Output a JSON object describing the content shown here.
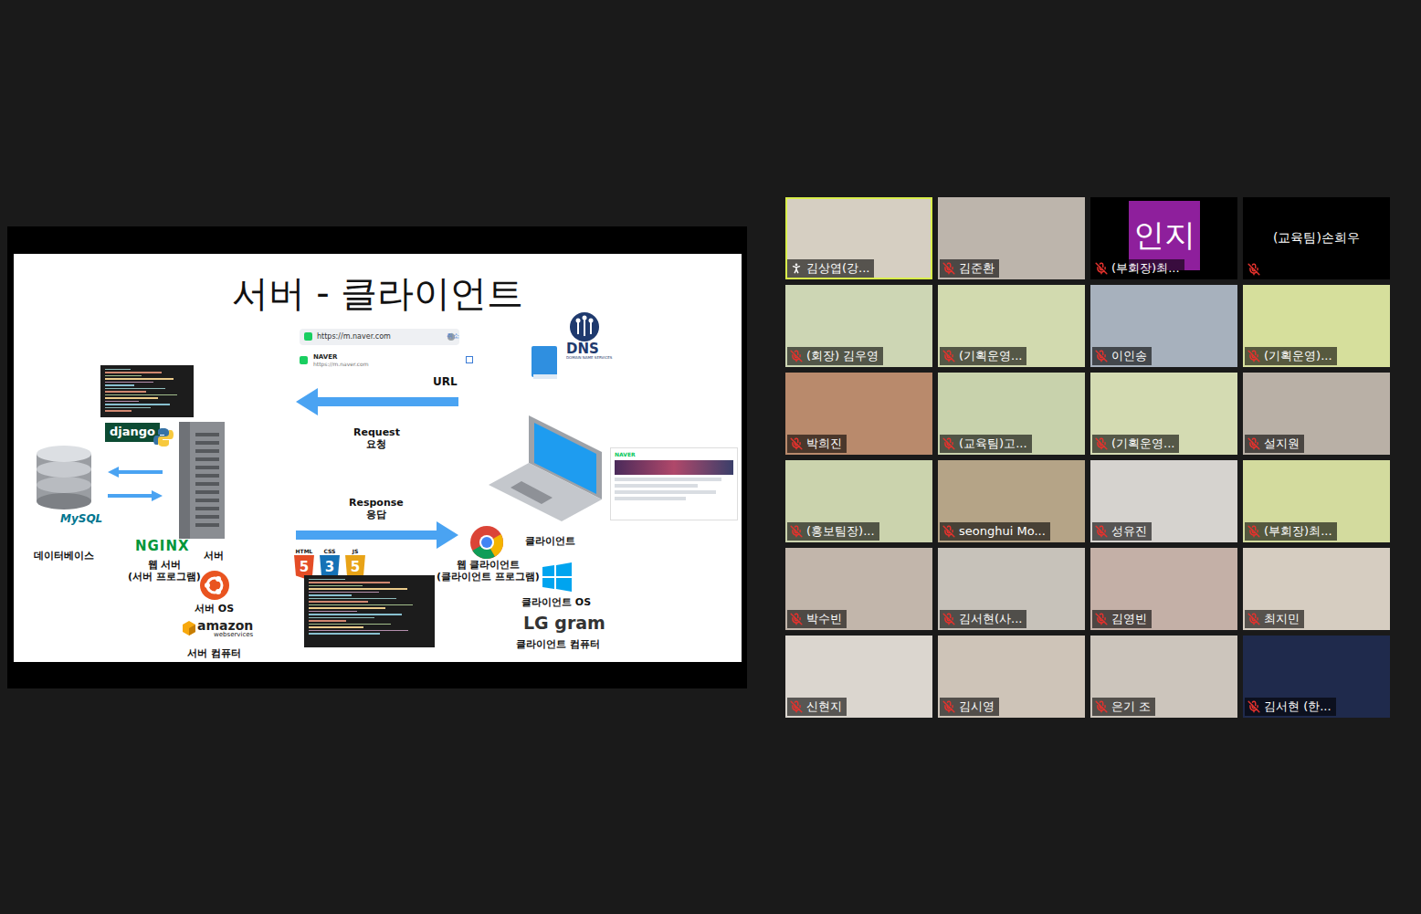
{
  "slide": {
    "title": "서버 - 클라이언트",
    "address_bar": {
      "url": "https://m.naver.com",
      "cancel": "취소",
      "suggestion_title": "NAVER",
      "suggestion_url": "https://m.naver.com"
    },
    "dns": {
      "label": "DNS",
      "caption": "DOMAIN NAME SERVICES"
    },
    "url_label": "URL",
    "request": {
      "label": "Request",
      "caption": "요청"
    },
    "response": {
      "label": "Response",
      "caption": "응답"
    },
    "server_side": {
      "database": "데이터베이스",
      "database_logo": "MySQL",
      "framework_logo": "django",
      "web_server_logo": "NGINX",
      "web_server": "웹 서버",
      "web_server_note": "(서버 프로그램)",
      "server": "서버",
      "server_os": "서버 OS",
      "cloud_logo": "amazon",
      "cloud_logo_sub": "webservices",
      "server_computer": "서버 컴퓨터"
    },
    "client_side": {
      "client": "클라이언트",
      "web_client": "웹 클라이언트",
      "web_client_note": "(클라이언트 프로그램)",
      "client_os": "클라이언트 OS",
      "computer_logo": "LG gram",
      "client_computer": "클라이언트 컴퓨터"
    },
    "web_tech": [
      {
        "label": "HTML",
        "glyph": "5",
        "color": "#e44d26"
      },
      {
        "label": "CSS",
        "glyph": "3",
        "color": "#1572b6"
      },
      {
        "label": "JS",
        "glyph": "5",
        "color": "#e8a317"
      }
    ],
    "naver_page": {
      "logo": "NAVER"
    }
  },
  "participants": [
    {
      "name": "김상엽(강...",
      "kind": "video",
      "speaking": true,
      "muted": false,
      "spotlighted": true,
      "avatar": "",
      "color": "#d6cfc2"
    },
    {
      "name": "김준환",
      "kind": "video",
      "speaking": false,
      "muted": true,
      "spotlighted": false,
      "avatar": "",
      "color": "#bdb5ac"
    },
    {
      "name": "(부회장)최...",
      "kind": "avatar",
      "speaking": false,
      "muted": true,
      "spotlighted": false,
      "avatar": "인지",
      "color": "#8e1f9c"
    },
    {
      "name": "(교육팀)손희우",
      "kind": "name-only",
      "speaking": false,
      "muted": true,
      "spotlighted": false,
      "avatar": "",
      "color": "#000000"
    },
    {
      "name": "(회장) 김우영",
      "kind": "video",
      "speaking": false,
      "muted": true,
      "spotlighted": false,
      "avatar": "",
      "color": "#cdd6b4"
    },
    {
      "name": "(기획운영...",
      "kind": "video",
      "speaking": false,
      "muted": true,
      "spotlighted": false,
      "avatar": "",
      "color": "#d2daaf"
    },
    {
      "name": "이인송",
      "kind": "video",
      "speaking": false,
      "muted": true,
      "spotlighted": false,
      "avatar": "",
      "color": "#a7b1bd"
    },
    {
      "name": "(기획운영)...",
      "kind": "video",
      "speaking": false,
      "muted": true,
      "spotlighted": false,
      "avatar": "",
      "color": "#d6df9c"
    },
    {
      "name": "박희진",
      "kind": "video",
      "speaking": false,
      "muted": true,
      "spotlighted": false,
      "avatar": "",
      "color": "#b98a6c"
    },
    {
      "name": "(교육팀)고...",
      "kind": "video",
      "speaking": false,
      "muted": true,
      "spotlighted": false,
      "avatar": "",
      "color": "#c8d2ac"
    },
    {
      "name": "(기획운영...",
      "kind": "video",
      "speaking": false,
      "muted": true,
      "spotlighted": false,
      "avatar": "",
      "color": "#d4dbb2"
    },
    {
      "name": "설지원",
      "kind": "video",
      "speaking": false,
      "muted": true,
      "spotlighted": false,
      "avatar": "",
      "color": "#b9b0a6"
    },
    {
      "name": "(홍보팀장)...",
      "kind": "video",
      "speaking": false,
      "muted": true,
      "spotlighted": false,
      "avatar": "",
      "color": "#cbd3ad"
    },
    {
      "name": "seonghui Mo...",
      "kind": "video",
      "speaking": false,
      "muted": true,
      "spotlighted": false,
      "avatar": "",
      "color": "#b5a487"
    },
    {
      "name": "성유진",
      "kind": "video",
      "speaking": false,
      "muted": true,
      "spotlighted": false,
      "avatar": "",
      "color": "#d6d3cf"
    },
    {
      "name": "(부회장)최...",
      "kind": "video",
      "speaking": false,
      "muted": true,
      "spotlighted": false,
      "avatar": "",
      "color": "#d3db9e"
    },
    {
      "name": "박수빈",
      "kind": "video",
      "speaking": false,
      "muted": true,
      "spotlighted": false,
      "avatar": "",
      "color": "#c2b6ab"
    },
    {
      "name": "김서현(사...",
      "kind": "video",
      "speaking": false,
      "muted": true,
      "spotlighted": false,
      "avatar": "",
      "color": "#c7c2ba"
    },
    {
      "name": "김영빈",
      "kind": "video",
      "speaking": false,
      "muted": true,
      "spotlighted": false,
      "avatar": "",
      "color": "#c4b0a7"
    },
    {
      "name": "최지민",
      "kind": "video",
      "speaking": false,
      "muted": true,
      "spotlighted": false,
      "avatar": "",
      "color": "#d6cdc1"
    },
    {
      "name": "신현지",
      "kind": "video",
      "speaking": false,
      "muted": true,
      "spotlighted": false,
      "avatar": "",
      "color": "#dbd6cf"
    },
    {
      "name": "김시영",
      "kind": "video",
      "speaking": false,
      "muted": true,
      "spotlighted": false,
      "avatar": "",
      "color": "#cec4b8"
    },
    {
      "name": "은기 조",
      "kind": "video",
      "speaking": false,
      "muted": true,
      "spotlighted": false,
      "avatar": "",
      "color": "#ccc5bc"
    },
    {
      "name": "김서현 (한...",
      "kind": "video",
      "speaking": false,
      "muted": true,
      "spotlighted": false,
      "avatar": "",
      "color": "#1f2a4c"
    }
  ]
}
